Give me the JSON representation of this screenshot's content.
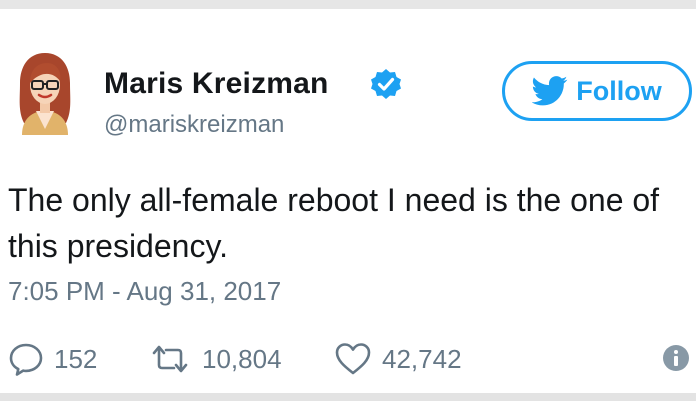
{
  "author": {
    "name": "Maris Kreizman",
    "handle": "@mariskreizman",
    "verified": true
  },
  "follow_button": {
    "label": "Follow"
  },
  "tweet": {
    "text": "The only all-female reboot I need is the one of this presidency.",
    "timestamp": "7:05 PM - Aug 31, 2017"
  },
  "stats": {
    "replies": "152",
    "retweets": "10,804",
    "likes": "42,742"
  },
  "colors": {
    "twitter_blue": "#1da1f2",
    "secondary_text": "#657786",
    "primary_text": "#14171a"
  },
  "icons": {
    "verified": "verified-badge-icon",
    "follow": "twitter-bird-icon",
    "reply": "speech-bubble-icon",
    "retweet": "retweet-arrows-icon",
    "like": "heart-icon",
    "info": "info-circle-icon"
  }
}
